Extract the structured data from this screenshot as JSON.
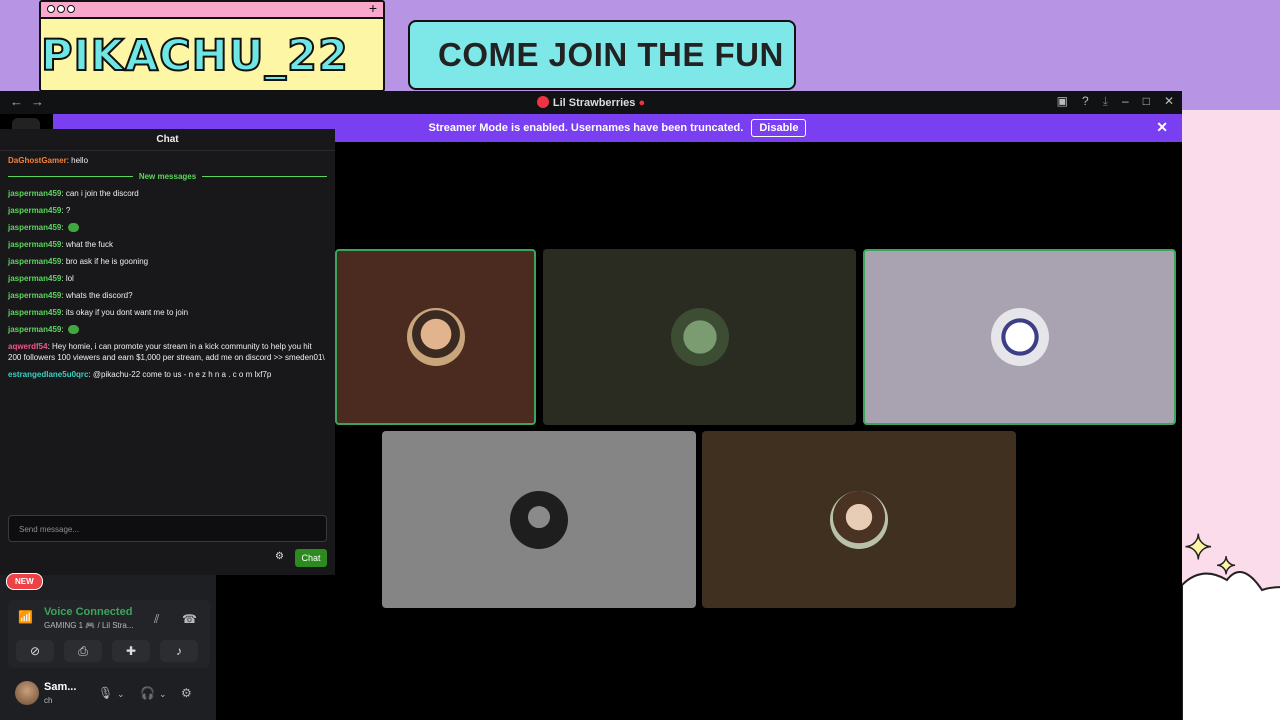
{
  "overlay": {
    "streamer_name": "PIKACHU_22",
    "join_text": "COME JOIN THE FUN",
    "window_plus": "+"
  },
  "titlebar": {
    "back": "←",
    "forward": "→",
    "server_title": "Lil Strawberries"
  },
  "banner": {
    "text": "Streamer Mode is enabled. Usernames have been truncated.",
    "disable_label": "Disable",
    "close": "✕"
  },
  "chat": {
    "title": "Chat",
    "new_messages_label": "New messages",
    "input_placeholder": "Send message...",
    "send_label": "Chat",
    "messages": [
      {
        "user": "DaGhostGamer",
        "text": ": hello",
        "color": "#f5813b",
        "emote": false
      },
      {
        "user": "jasperman459",
        "text": ": can i join the discord",
        "color": "#5bd65b",
        "emote": false
      },
      {
        "user": "jasperman459",
        "text": ": ?",
        "color": "#5bd65b",
        "emote": false
      },
      {
        "user": "jasperman459",
        "text": ":",
        "color": "#5bd65b",
        "emote": true
      },
      {
        "user": "jasperman459",
        "text": ": what the fuck",
        "color": "#5bd65b",
        "emote": false
      },
      {
        "user": "jasperman459",
        "text": ": bro ask if he is gooning",
        "color": "#5bd65b",
        "emote": false
      },
      {
        "user": "jasperman459",
        "text": ": lol",
        "color": "#5bd65b",
        "emote": false
      },
      {
        "user": "jasperman459",
        "text": ": whats the discord?",
        "color": "#5bd65b",
        "emote": false
      },
      {
        "user": "jasperman459",
        "text": ": its okay if you dont want me to join",
        "color": "#5bd65b",
        "emote": false
      },
      {
        "user": "jasperman459",
        "text": ":",
        "color": "#5bd65b",
        "emote": true
      },
      {
        "user": "aqwerdf54",
        "text": ": Hey homie, i can promote your stream in a kick community to help you hit 200 followers 100 viewers and earn $1,000 per stream, add me on discord >> smeden01\\",
        "color": "#f0558c",
        "emote": false
      },
      {
        "user": "estrangedlane5u0qrc",
        "text": ": @pikachu-22 come to us - n e z h n a . c o m lxf7p",
        "color": "#39d1c4",
        "emote": false
      }
    ]
  },
  "voice": {
    "status": "Voice Connected",
    "channel": "GAMING 1 🎮 / Lil Stra...",
    "new_badge": "NEW",
    "user_name": "Sam...",
    "user_status": "ch"
  },
  "colors": {
    "speaking_border": "#3ba55c",
    "banner": "#7b3ff2"
  }
}
